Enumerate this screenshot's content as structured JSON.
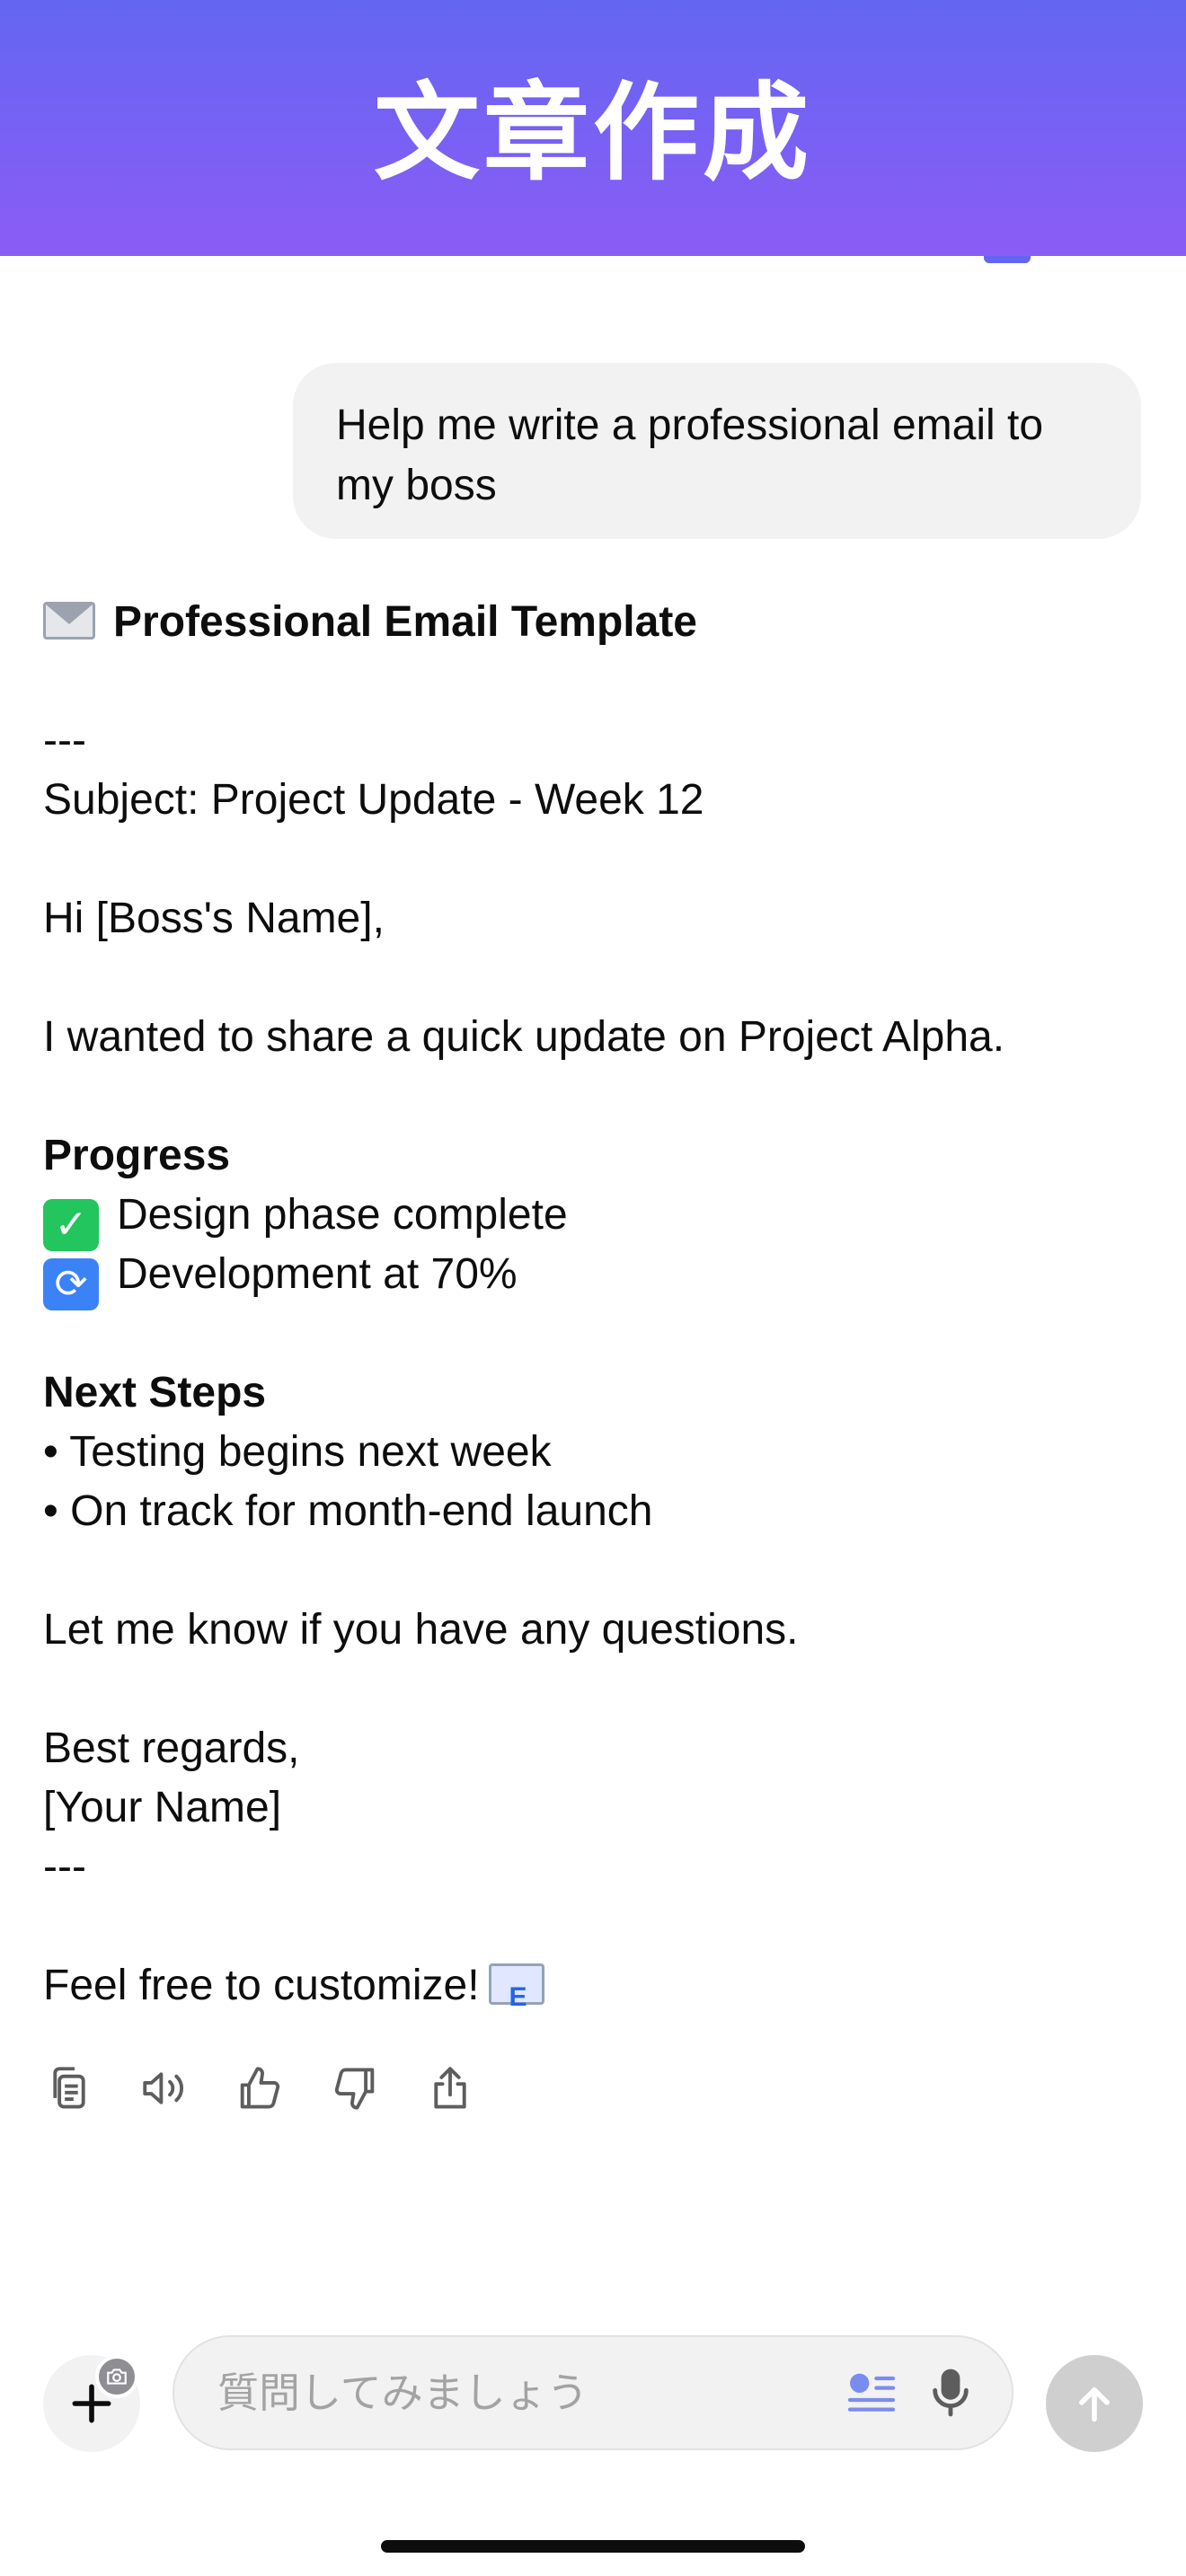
{
  "header": {
    "title": "文章作成",
    "gradient_start": "#6366f1",
    "gradient_end": "#8b5cf6"
  },
  "conversation": {
    "user_message": "Help me write a professional email to my boss",
    "assistant": {
      "heading": "Professional Email Template",
      "heading_icon": "envelope-icon",
      "divider_top": "---",
      "subject": "Subject: Project Update - Week 12",
      "greeting": "Hi [Boss's Name],",
      "intro": "I wanted to share a quick update on Project Alpha.",
      "progress_heading": "Progress",
      "progress_items": [
        {
          "icon": "check-mark-icon",
          "text": "Design phase complete"
        },
        {
          "icon": "cycle-arrows-icon",
          "text": "Development at 70%"
        }
      ],
      "next_steps_heading": "Next Steps",
      "next_steps_items": [
        "• Testing begins next week",
        "• On track for month-end launch"
      ],
      "closing_question": "Let me know if you have any questions.",
      "signoff": "Best regards,",
      "signature": "[Your Name]",
      "divider_bottom": "---",
      "footer": "Feel free to customize!",
      "footer_icon": "incoming-envelope-icon"
    }
  },
  "actions": [
    "copy-icon",
    "read-aloud-icon",
    "thumbs-up-icon",
    "thumbs-down-icon",
    "share-icon"
  ],
  "composer": {
    "placeholder": "質問してみましょう",
    "value": "",
    "plus_icon": "plus-icon",
    "camera_icon": "camera-icon",
    "quick_icon": "quick-actions-icon",
    "mic_icon": "microphone-icon",
    "send_icon": "arrow-up-icon"
  }
}
